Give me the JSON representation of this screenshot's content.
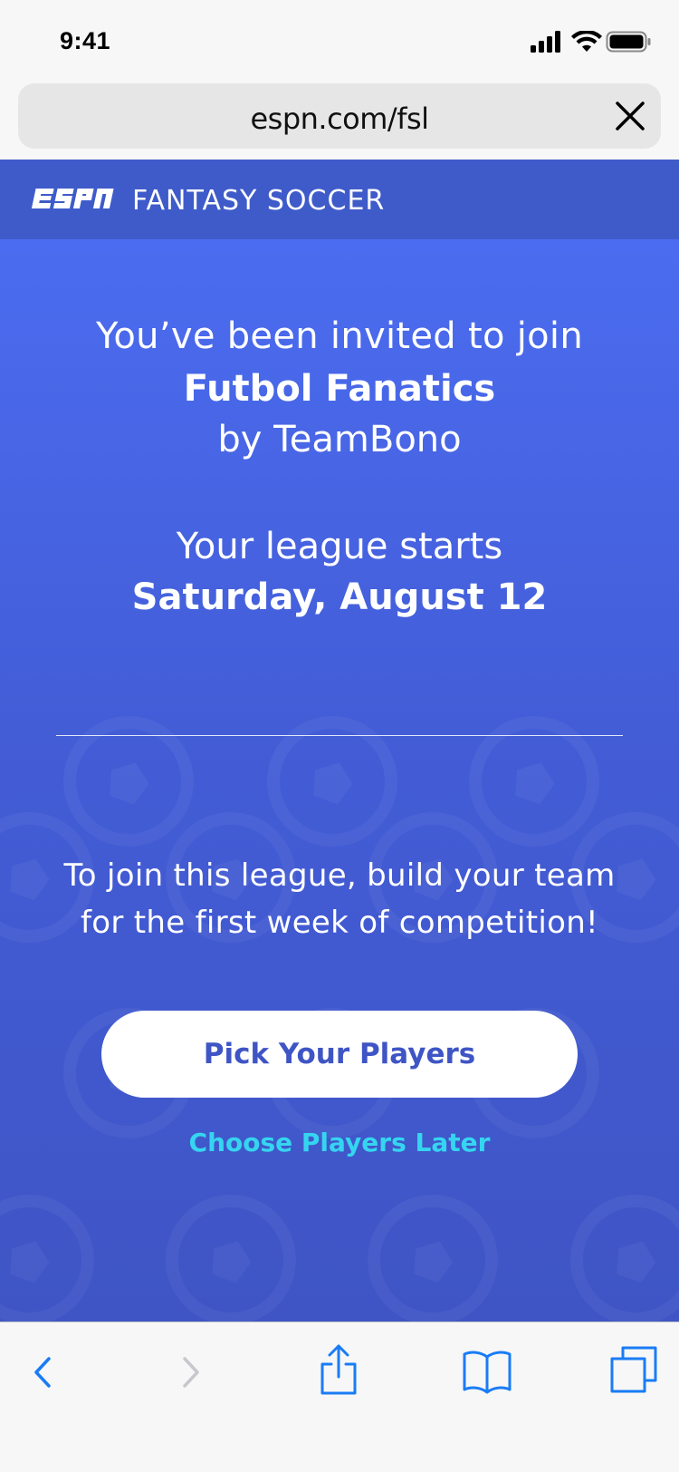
{
  "status_bar": {
    "time": "9:41"
  },
  "browser": {
    "url": "espn.com/fsl"
  },
  "header": {
    "title": "FANTASY SOCCER"
  },
  "invite": {
    "line1": "You’ve been invited to join",
    "league_name": "Futbol Fanatics",
    "by_line": "by TeamBono",
    "starts_line": "Your league starts",
    "start_date": "Saturday, August 12"
  },
  "instructions": {
    "line1": "To join this league, build your team",
    "line2": "for the first week of competition!"
  },
  "actions": {
    "primary_label": "Pick Your Players",
    "secondary_label": "Choose Players Later"
  },
  "colors": {
    "header_bg": "#3e5bc9",
    "hero_top": "#4b6cf0",
    "hero_bottom": "#3f55c5",
    "link": "#35d5f0",
    "ios_blue": "#1a7cf5"
  },
  "toolbar": {
    "icons": [
      "back-icon",
      "forward-icon",
      "share-icon",
      "bookmarks-icon",
      "tabs-icon"
    ]
  }
}
